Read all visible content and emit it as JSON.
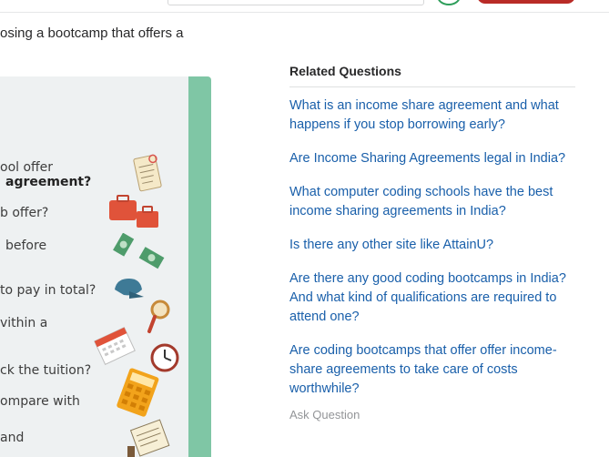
{
  "question": {
    "text": "osing a bootcamp that offers a"
  },
  "infographic": {
    "lines": [
      "ool offer",
      "agreement?",
      "b offer?",
      "before",
      "to pay in total?",
      "vithin a",
      "ck the tuition?",
      "ompare with",
      "and"
    ],
    "icons": [
      "clipboard-icon",
      "briefcase-icon",
      "money-icon",
      "cap-icon",
      "magnifier-icon",
      "calendar-icon",
      "clock-icon",
      "calculator-icon",
      "document-icon"
    ]
  },
  "related": {
    "title": "Related Questions",
    "items": [
      "What is an income share agreement and what happens if you stop borrowing early?",
      "Are Income Sharing Agreements legal in India?",
      "What computer coding schools have the best income sharing agreements in India?",
      "Is there any other site like AttainU?",
      "Are there any good coding bootcamps in India? And what kind of qualifications are required to attend one?",
      "Are coding bootcamps that offer offer income-share agreements to take care of costs worthwhile?"
    ],
    "ask_label": "Ask Question"
  },
  "colors": {
    "link": "#195faa",
    "accent_green": "#7fc6a5",
    "brand_red": "#b92b27"
  }
}
